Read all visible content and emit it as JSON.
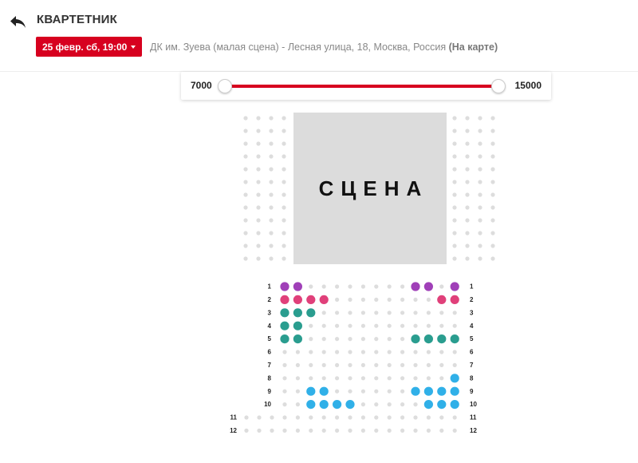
{
  "header": {
    "title": "КВАРТЕТНИК",
    "date_label": "25 февр. сб, 19:00",
    "venue_text": "ДК им. Зуева (малая сцена) - Лесная улица, 18, Москва, Россия",
    "map_link": "(На карте)"
  },
  "price_filter": {
    "min_label": "7000",
    "max_label": "15000",
    "min_value": 7000,
    "max_value": 15000
  },
  "stage": {
    "label": "СЦЕНА"
  },
  "colors": {
    "accent": "#d7001f",
    "seat_empty": "#dddddd",
    "purple": "#a040b8",
    "pink": "#e0407a",
    "teal": "#2a9d8f",
    "blue": "#30b0e8"
  },
  "seating": {
    "row_labels": [
      "1",
      "2",
      "3",
      "4",
      "5",
      "6",
      "7",
      "8",
      "9",
      "10",
      "11",
      "12"
    ],
    "seats_per_row": 14,
    "wide_rows": [
      "11",
      "12"
    ],
    "available": [
      {
        "row": "1",
        "seats": [
          1,
          2,
          11,
          12,
          14
        ],
        "color": "purple"
      },
      {
        "row": "2",
        "seats": [
          1,
          2,
          3,
          4,
          13,
          14
        ],
        "color": "pink"
      },
      {
        "row": "3",
        "seats": [
          1,
          2,
          3
        ],
        "color": "teal"
      },
      {
        "row": "4",
        "seats": [
          1,
          2
        ],
        "color": "teal"
      },
      {
        "row": "5",
        "seats": [
          1,
          2,
          11,
          12,
          13,
          14
        ],
        "color": "teal"
      },
      {
        "row": "8",
        "seats": [
          14
        ],
        "color": "blue"
      },
      {
        "row": "9",
        "seats": [
          3,
          4,
          11,
          12,
          13,
          14
        ],
        "color": "blue"
      },
      {
        "row": "10",
        "seats": [
          3,
          4,
          5,
          6,
          12,
          13,
          14
        ],
        "color": "blue"
      }
    ]
  }
}
